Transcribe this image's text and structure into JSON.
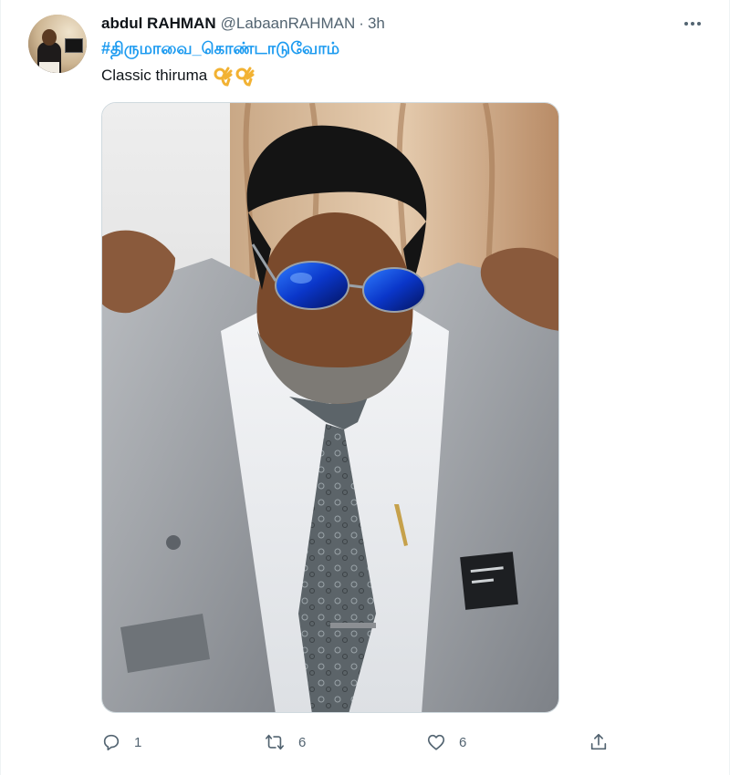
{
  "author": {
    "display_name": "abdul RAHMAN",
    "handle": "@LabaanRAHMAN",
    "separator": "·",
    "time": "3h"
  },
  "tweet": {
    "hashtag": "#திருமாவை_கொண்டாடுவோம்",
    "text": "Classic thiruma",
    "emoji_icon": "ok-hand-emoji"
  },
  "actions": {
    "reply_count": "1",
    "retweet_count": "6",
    "like_count": "6"
  },
  "colors": {
    "link": "#1d9bf0",
    "secondary_text": "#536471",
    "primary_text": "#0f1419"
  }
}
